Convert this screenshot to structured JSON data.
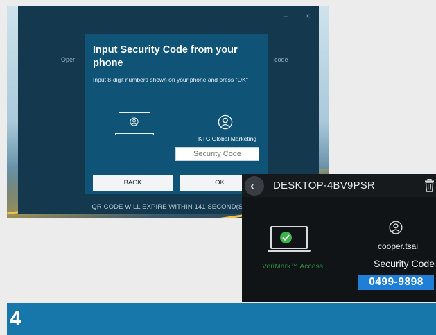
{
  "desktop_app": {
    "background_left_text": "Oper",
    "background_right_text": "code",
    "window_controls": {
      "minimize": "–",
      "close": "×"
    },
    "dialog": {
      "title": "Input Security Code from your phone",
      "description": "Input 8-digit numbers shown on your phone and press \"OK\"",
      "company_name": "KTG Global Marketing",
      "code_input": {
        "placeholder": "Security Code",
        "value": ""
      },
      "back_button": "BACK",
      "ok_button": "OK"
    },
    "expire_notice": "QR CODE WILL EXPIRE WITHIN 141 SECOND(S)"
  },
  "phone_app": {
    "back_icon": "‹",
    "device_name": "DESKTOP-4BV9PSR",
    "product_label": "VeriMark™ Access",
    "username": "cooper.tsai",
    "security_code_label": "Security Code",
    "security_code": "0499-9898"
  },
  "step": {
    "number": "4"
  },
  "colors": {
    "dialog_bg": "#0f5477",
    "window_bg": "#14384e",
    "banner": "#1877aa",
    "code_highlight": "#1f7fd6",
    "verimark_green": "#2b8a3a",
    "check_green": "#39b54a"
  },
  "icons": [
    "laptop-icon",
    "user-icon",
    "back-arrow-icon",
    "trash-icon",
    "check-icon"
  ]
}
